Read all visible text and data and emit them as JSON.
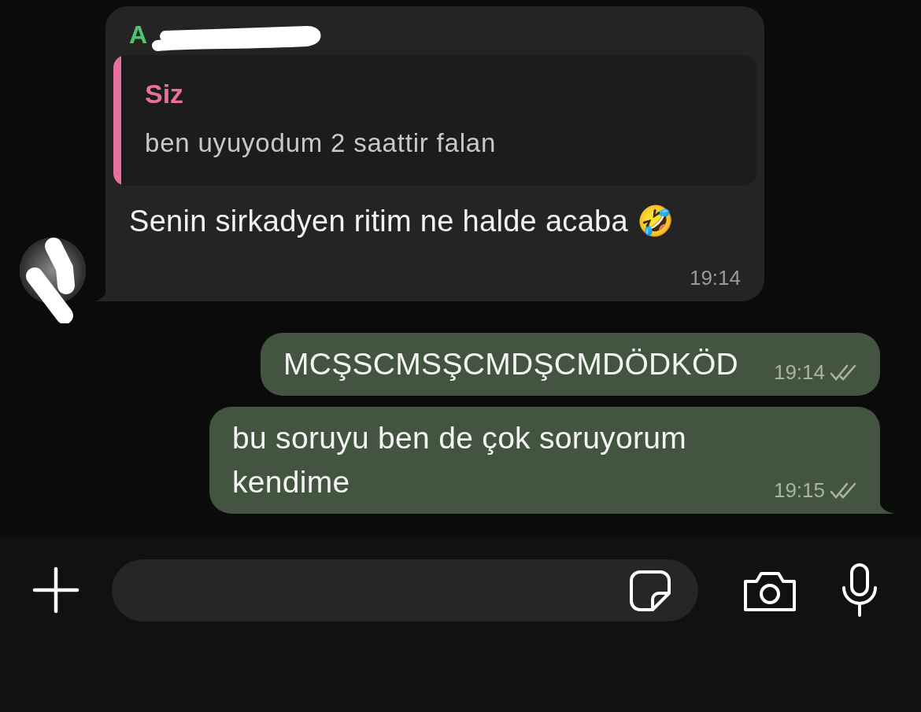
{
  "messages": [
    {
      "kind": "incoming",
      "sender": "A",
      "quote": {
        "author": "Siz",
        "text": "ben uyuyodum 2 saattir falan"
      },
      "text": "Senin sirkadyen ritim ne halde acaba 🤣",
      "time": "19:14",
      "tail": true
    },
    {
      "kind": "outgoing",
      "text": "MCŞSCMSŞCMDŞCMDÖDKÖD",
      "time": "19:14",
      "read": false,
      "tail": false
    },
    {
      "kind": "outgoing",
      "text": "bu soruyu ben de çok soruyorum kendime",
      "time": "19:15",
      "read": false,
      "tail": true
    }
  ]
}
